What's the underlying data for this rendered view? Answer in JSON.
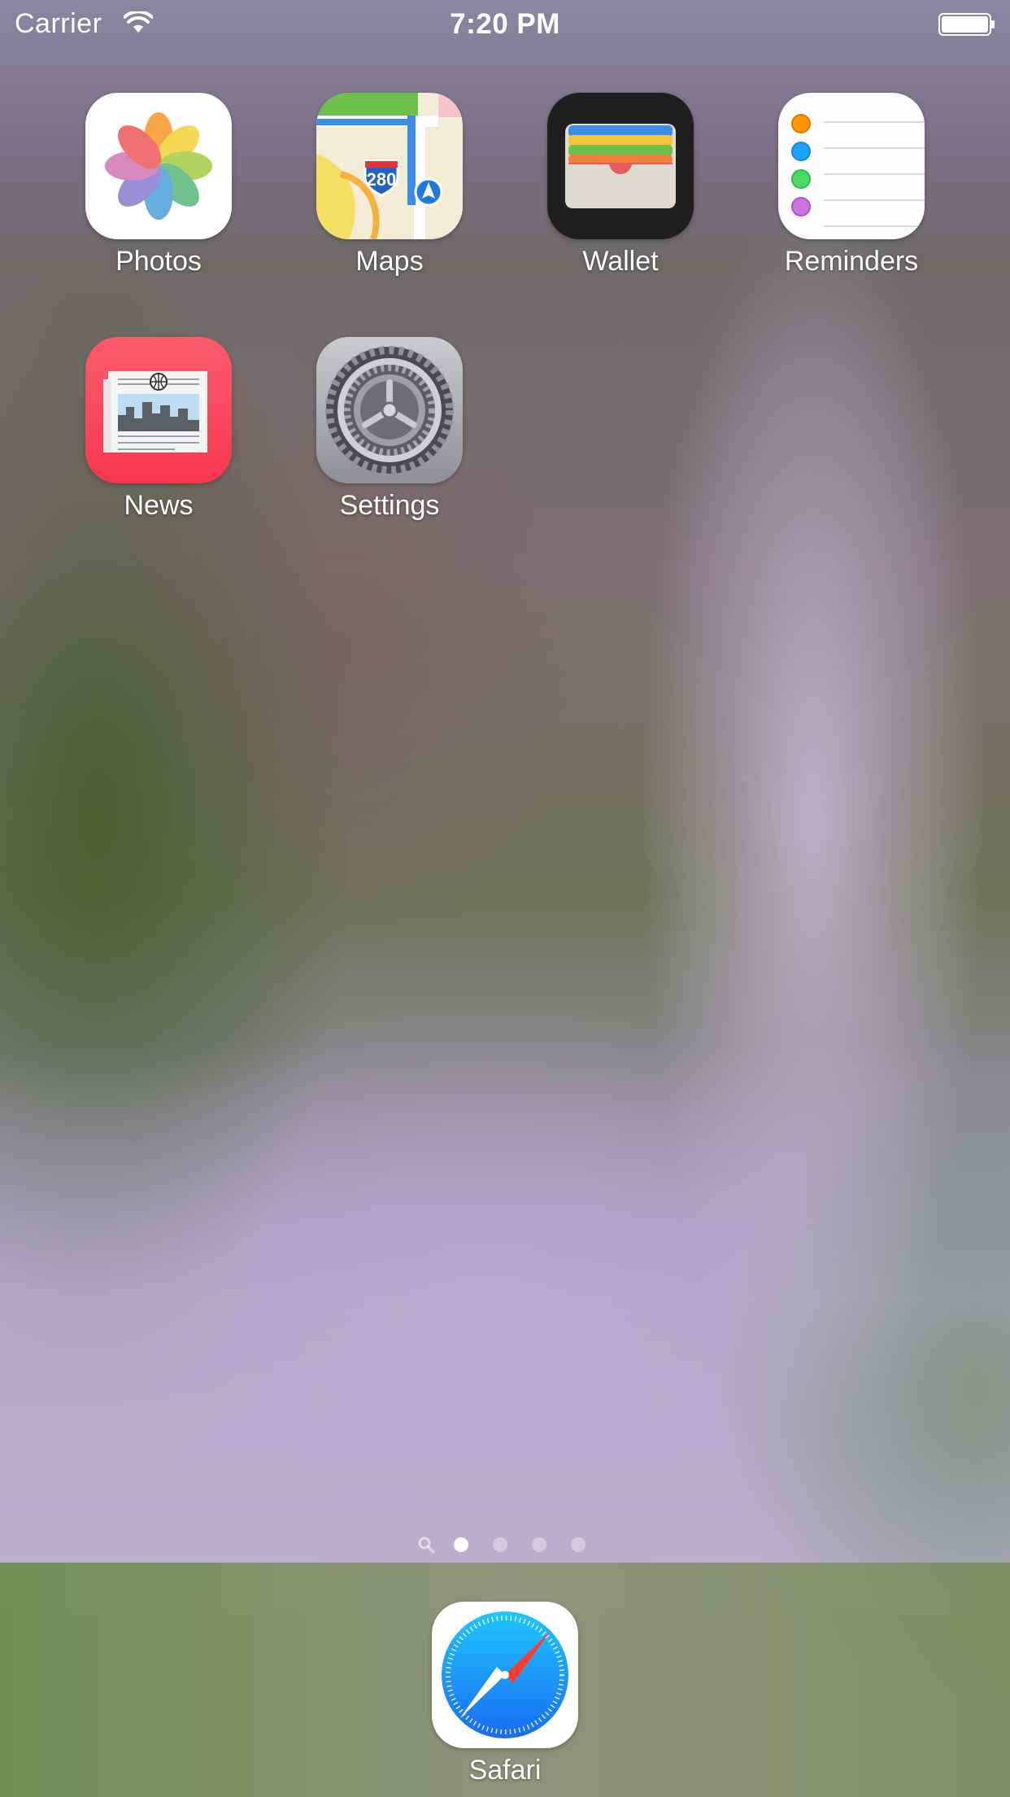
{
  "status_bar": {
    "carrier": "Carrier",
    "time": "7:20 PM"
  },
  "home": {
    "apps": [
      {
        "label": "Photos",
        "icon": "photos-icon"
      },
      {
        "label": "Maps",
        "icon": "maps-icon",
        "shield_number": "280"
      },
      {
        "label": "Wallet",
        "icon": "wallet-icon"
      },
      {
        "label": "Reminders",
        "icon": "reminders-icon"
      },
      {
        "label": "News",
        "icon": "news-icon"
      },
      {
        "label": "Settings",
        "icon": "settings-icon"
      }
    ]
  },
  "page_indicator": {
    "pages": 4,
    "current": 1,
    "has_spotlight": true
  },
  "dock": {
    "apps": [
      {
        "label": "Safari",
        "icon": "safari-icon"
      }
    ]
  },
  "colors": {
    "news_red": "#f9485e",
    "wallet_black": "#1f1f1f",
    "safari_blue": "#1a8cff",
    "maps_green": "#6cc04a",
    "reminder_orange": "#ff9500",
    "reminder_blue": "#1aa3ff",
    "reminder_green": "#4cd964",
    "reminder_purple": "#cc73e1"
  }
}
